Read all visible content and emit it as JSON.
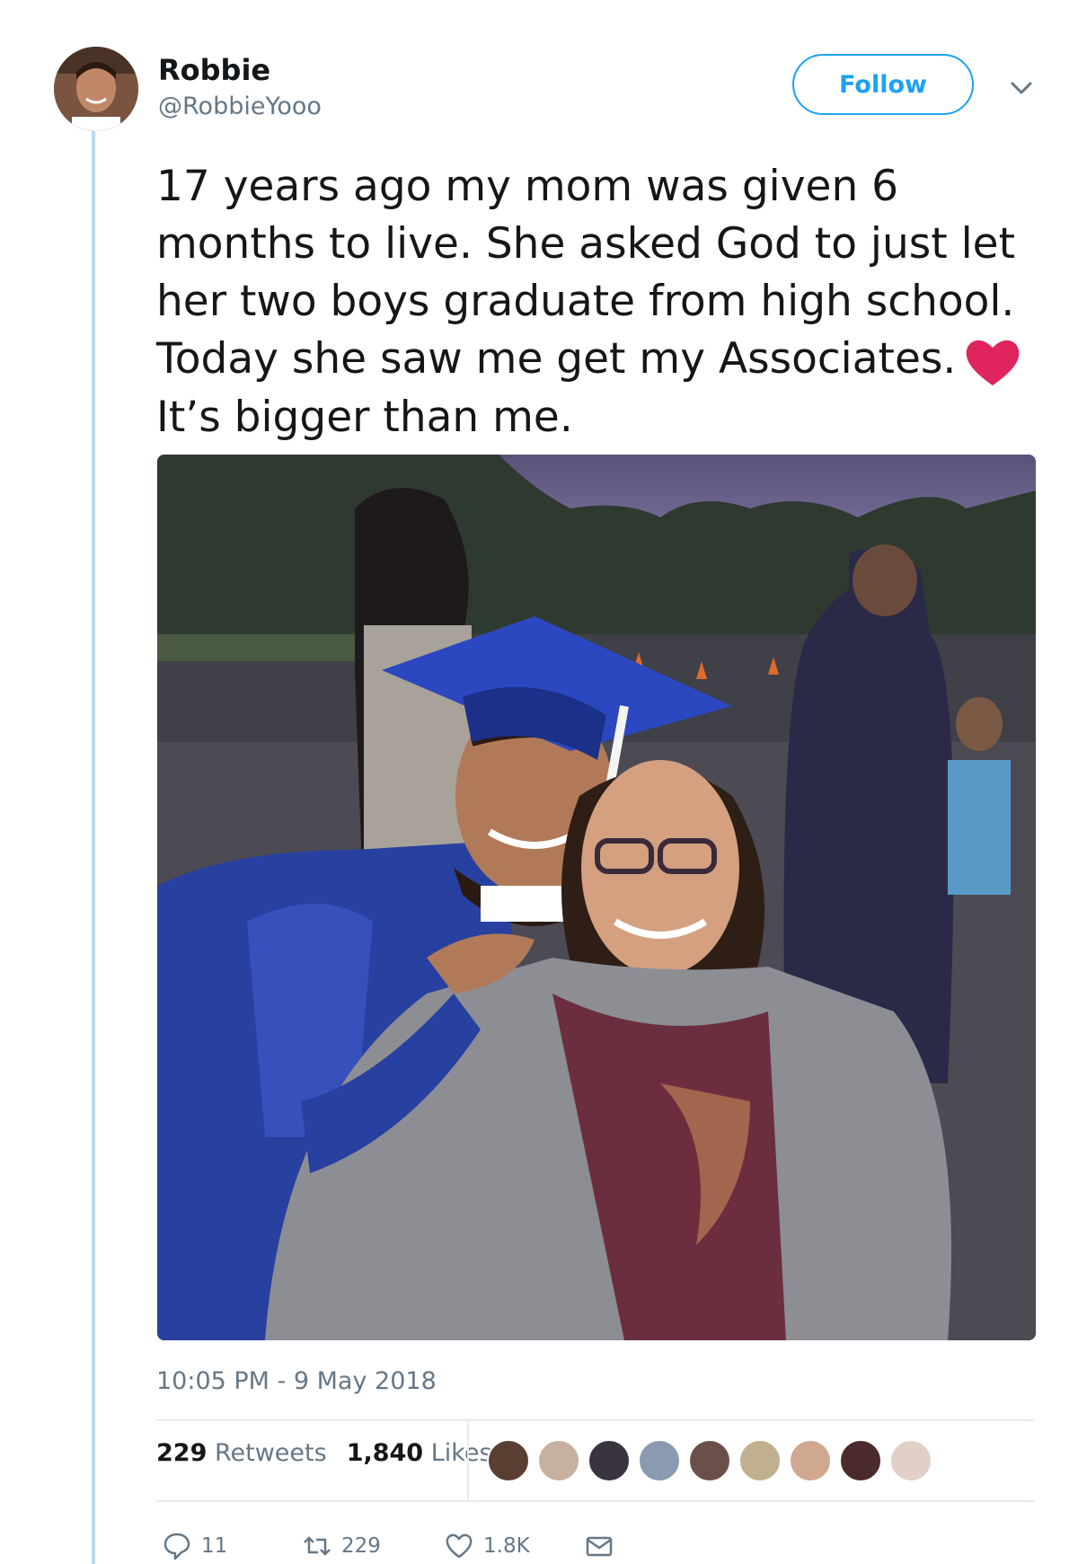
{
  "user": {
    "name": "Robbie",
    "handle": "@RobbieYooo"
  },
  "follow_label": "Follow",
  "tweet": {
    "lines": [
      "17 years ago my mom was given 6",
      "months to live. She asked God to just let",
      "her two boys graduate from high school.",
      "Today she saw me get my Associates.",
      "It’s bigger than me."
    ],
    "emoji": "heart-icon"
  },
  "timestamp": "10:05 PM - 9 May 2018",
  "stats": {
    "retweets_count": "229",
    "retweets_label": "Retweets",
    "likes_count": "1,840",
    "likes_label": "Likes"
  },
  "likers_count": 9,
  "actions": {
    "replies": "11",
    "retweets": "229",
    "likes": "1.8K"
  },
  "colors": {
    "accent": "#1da1f2",
    "heart": "#e0245e",
    "muted": "#657786",
    "thread_line": "#b8dcef"
  }
}
